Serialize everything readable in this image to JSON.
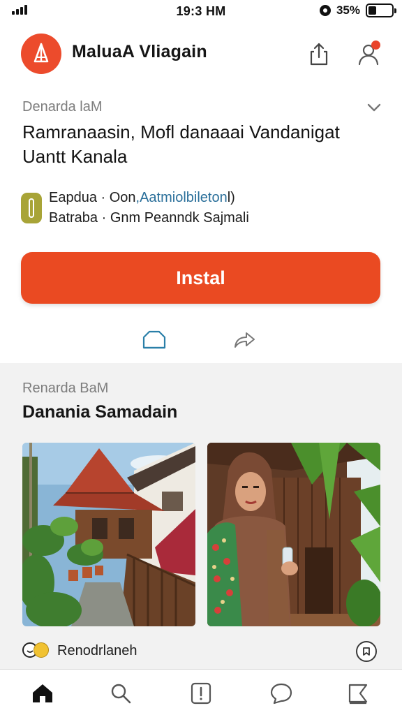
{
  "status_bar": {
    "time": "19:3 HM",
    "battery_percent": "35%",
    "battery_level": 0.35
  },
  "app": {
    "name": "MaluaA Vliagain",
    "notification_indicator": true
  },
  "detail": {
    "meta_label": "Denarda laM",
    "headline": "Ramranaasin, Mofl danaaai Vandanigat Uantt Kanala",
    "developer_line_1_prefix": "Eapdua · Oon",
    "developer_line_1_highlight": ",Aatmiolbileton",
    "developer_line_1_suffix": "l)",
    "developer_line_2": "Batraba · Gnm Peanndk Sajmali",
    "install_label": "Instal"
  },
  "section": {
    "label": "Renarda BaM",
    "title": "Danania Samadain",
    "reaction_text": "Renodrlaneh"
  },
  "icons": {
    "app_logo": "sail-logo-icon",
    "share": "share-icon",
    "account": "account-icon",
    "expand": "chevron-down-icon",
    "action_1": "home-outline-icon",
    "action_2": "share-arrow-icon",
    "bookmark": "bookmark-icon",
    "nav": [
      "home-icon",
      "search-icon",
      "alert-icon",
      "chat-icon",
      "library-icon"
    ]
  },
  "colors": {
    "accent": "#ea4a22",
    "developer_badge": "#a8a437",
    "link": "#2a6f9a",
    "notification": "#e9442c"
  }
}
